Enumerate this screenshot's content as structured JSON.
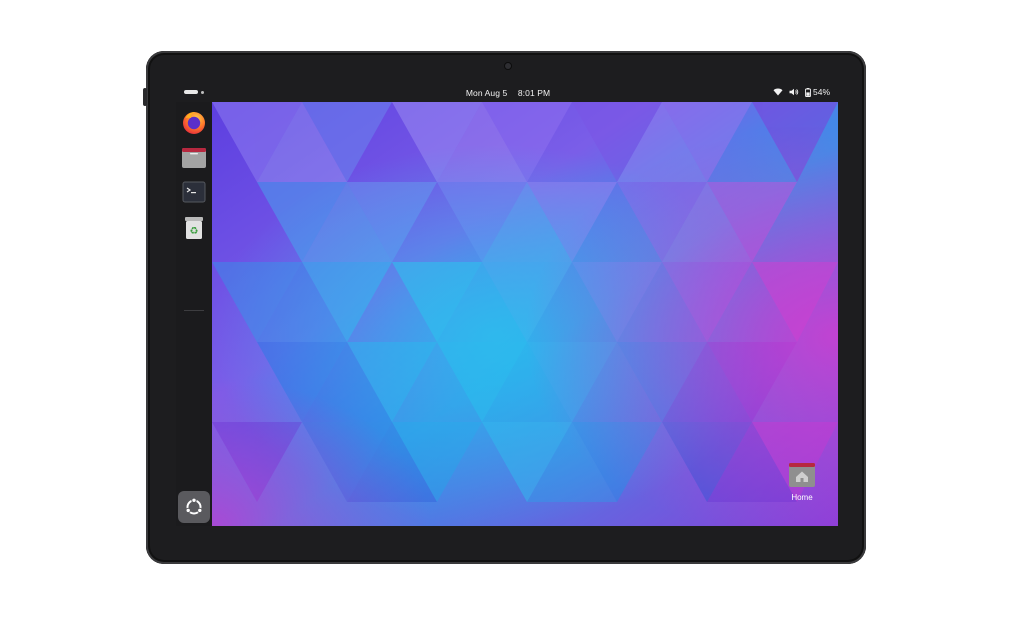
{
  "device": {
    "kind": "tablet"
  },
  "topbar": {
    "date": "Mon Aug 5",
    "time": "8:01 PM",
    "battery": "54%",
    "icons": [
      "activities-indicator",
      "wifi-icon",
      "volume-icon",
      "battery-icon"
    ]
  },
  "dock": {
    "items": [
      {
        "name": "firefox",
        "icon": "firefox-icon"
      },
      {
        "name": "files",
        "icon": "folder-icon"
      },
      {
        "name": "terminal",
        "icon": "terminal-icon"
      },
      {
        "name": "trash",
        "icon": "recycle-icon"
      }
    ],
    "show_apps_icon": "ubuntu-logo-icon"
  },
  "desktop": {
    "wallpaper": "purple-blue-geometric-triangles",
    "icons": [
      {
        "label": "Home",
        "icon": "home-folder-icon"
      }
    ]
  },
  "colors": {
    "bezel": "#1d1d1f",
    "wallpaper_primary": "#7b4fe0",
    "wallpaper_secondary": "#2aa3e8",
    "wallpaper_accent": "#c13fd6"
  }
}
